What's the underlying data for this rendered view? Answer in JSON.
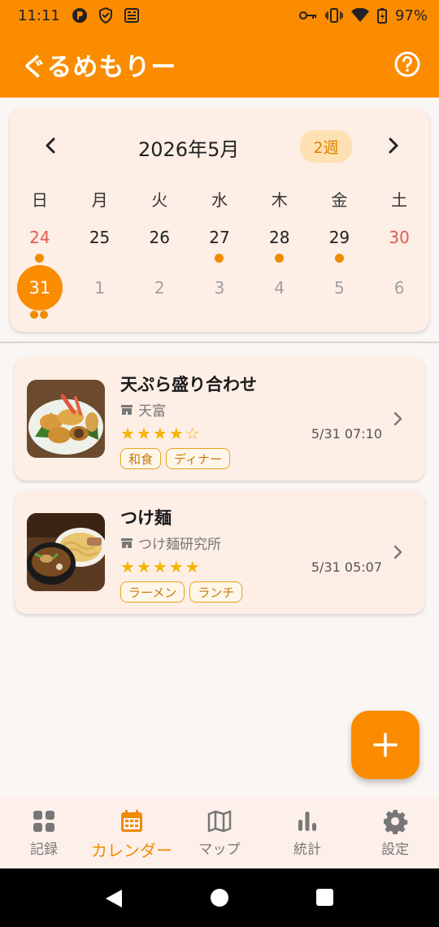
{
  "status_bar": {
    "time": "11:11",
    "battery": "97%",
    "left_icons": [
      "podcast-icon",
      "shield-check-icon",
      "news-icon"
    ],
    "right_icons": [
      "key-icon",
      "vibrate-icon",
      "wifi-icon",
      "battery-charging-icon"
    ]
  },
  "app_bar": {
    "title": "ぐるめもりー",
    "help_icon": "help-circle-icon"
  },
  "calendar": {
    "month_label": "2026年5月",
    "range_toggle": "2週",
    "weekdays": [
      "日",
      "月",
      "火",
      "水",
      "木",
      "金",
      "土"
    ],
    "week1": [
      {
        "day": "24",
        "has_record": true
      },
      {
        "day": "25",
        "has_record": false
      },
      {
        "day": "26",
        "has_record": false
      },
      {
        "day": "27",
        "has_record": true
      },
      {
        "day": "28",
        "has_record": true
      },
      {
        "day": "29",
        "has_record": true
      },
      {
        "day": "30",
        "has_record": false
      }
    ],
    "week2": [
      {
        "day": "31",
        "selected": true,
        "records": 2
      },
      {
        "day": "1",
        "next_month": true
      },
      {
        "day": "2",
        "next_month": true
      },
      {
        "day": "3",
        "next_month": true
      },
      {
        "day": "4",
        "next_month": true
      },
      {
        "day": "5",
        "next_month": true
      },
      {
        "day": "6",
        "next_month": true
      }
    ]
  },
  "records": [
    {
      "name": "天ぷら盛り合わせ",
      "shop": "天富",
      "rating": 4,
      "rating_max": 5,
      "datetime": "5/31 07:10",
      "tags": [
        "和食",
        "ディナー"
      ],
      "thumbnail": "tempura-photo"
    },
    {
      "name": "つけ麺",
      "shop": "つけ麺研究所",
      "rating": 5,
      "rating_max": 5,
      "datetime": "5/31 05:07",
      "tags": [
        "ラーメン",
        "ランチ"
      ],
      "thumbnail": "tsukemen-photo"
    }
  ],
  "bottom_nav": {
    "items": [
      {
        "label": "記録",
        "icon": "grid-icon",
        "active": false
      },
      {
        "label": "カレンダー",
        "icon": "calendar-icon",
        "active": true
      },
      {
        "label": "マップ",
        "icon": "map-icon",
        "active": false
      },
      {
        "label": "統計",
        "icon": "bar-chart-icon",
        "active": false
      },
      {
        "label": "設定",
        "icon": "gear-icon",
        "active": false
      }
    ]
  },
  "colors": {
    "primary": "#fb8c00",
    "card_bg": "#fdeee6",
    "star": "#f5b400",
    "weekend_red": "#e05a4e"
  }
}
